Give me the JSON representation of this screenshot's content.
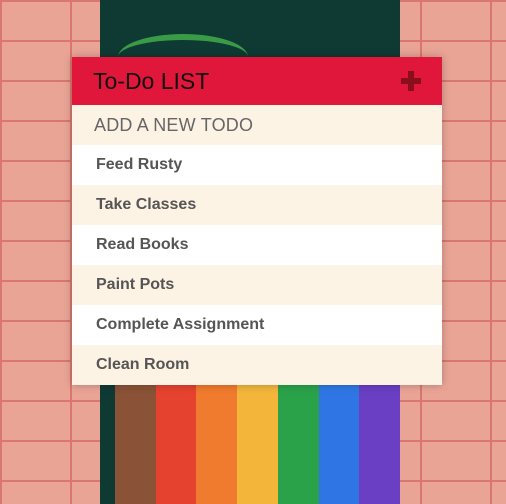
{
  "header": {
    "title": "To-Do LIST",
    "add_icon": "plus-icon"
  },
  "new_todo": {
    "placeholder": "ADD A NEW TODO",
    "value": ""
  },
  "todos": [
    {
      "label": "Feed Rusty"
    },
    {
      "label": "Take Classes"
    },
    {
      "label": "Read Books"
    },
    {
      "label": "Paint Pots"
    },
    {
      "label": "Complete Assignment"
    },
    {
      "label": "Clean Room"
    }
  ],
  "colors": {
    "header_bg": "#e0163b",
    "add_icon": "#8a0f1c",
    "row_alt": "#fdf3e5",
    "row": "#ffffff",
    "brick": "#e9a496"
  },
  "background": {
    "rainbow": [
      "#8a5236",
      "#e5432f",
      "#f07a2e",
      "#f3b63b",
      "#2aa24a",
      "#2f76e4",
      "#6a3fc4"
    ]
  }
}
